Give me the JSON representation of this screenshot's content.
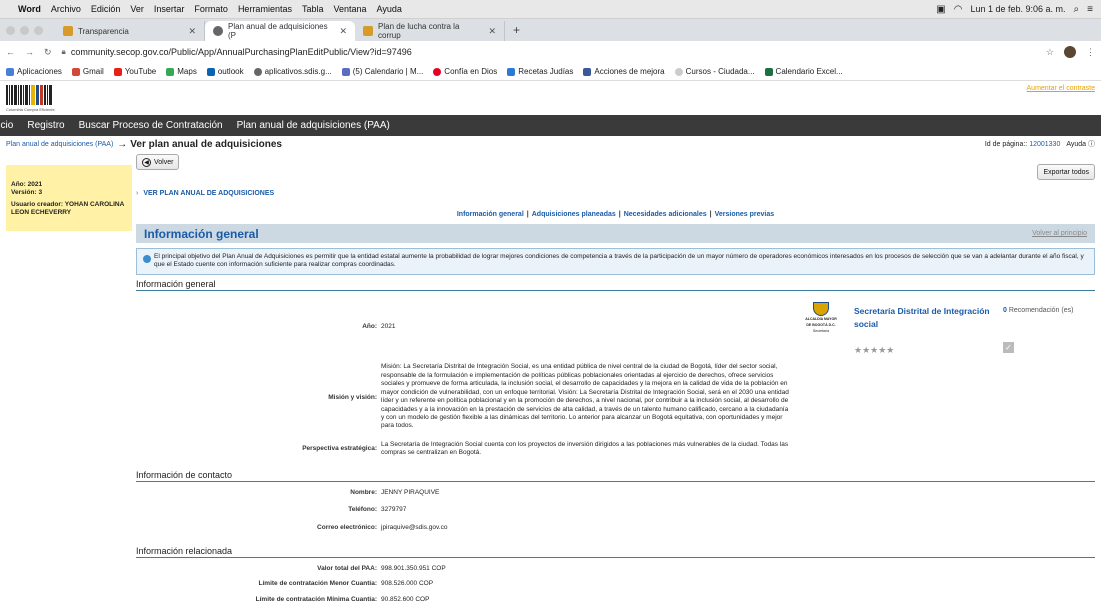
{
  "macbar": {
    "app": "Word",
    "menus": [
      "Archivo",
      "Edición",
      "Ver",
      "Insertar",
      "Formato",
      "Herramientas",
      "Tabla",
      "Ventana",
      "Ayuda"
    ],
    "datetime": "Lun 1 de feb. 9:06 a. m."
  },
  "tabs": [
    {
      "label": "Transparencia"
    },
    {
      "label": "Plan anual de adquisiciones (P"
    },
    {
      "label": "Plan de lucha contra la corrup"
    }
  ],
  "browser": {
    "url": "community.secop.gov.co/Public/App/AnnualPurchasingPlanEditPublic/View?id=97496"
  },
  "bookmarks": [
    "Aplicaciones",
    "Gmail",
    "YouTube",
    "Maps",
    "outlook",
    "aplicativos.sdis.g...",
    "(5) Calendario | M...",
    "Confía en Dios",
    "Recetas Judías",
    "Acciones de mejora",
    "Cursos - Ciudada...",
    "Calendario Excel..."
  ],
  "site": {
    "logo_text": "Colombia Compra Eficiente",
    "contrast_link": "Aumentar el contraste",
    "nav": [
      "Inicio",
      "Registro",
      "Buscar Proceso de Contratación",
      "Plan anual de adquisiciones (PAA)"
    ],
    "breadcrumb": "Plan anual de adquisiciones (PAA)",
    "arrow": "→",
    "title": "Ver plan anual de adquisiciones",
    "page_id_label": "Id de página::",
    "page_id": "12001330",
    "help": "Ayuda"
  },
  "left": {
    "year": "Año: 2021",
    "version": "Versión: 3",
    "creator": "Usuario creador: YOHAN CAROLINA LEON ECHEVERRY"
  },
  "buttons": {
    "back": "Volver",
    "export": "Exportar todos"
  },
  "ver_plan": "VER PLAN ANUAL DE ADQUISICIONES",
  "section_links": [
    "Información general",
    "Adquisiciones planeadas",
    "Necesidades adicionales",
    "Versiones previas"
  ],
  "info_header": {
    "title": "Información general",
    "back_top": "Volver al principio"
  },
  "info_text": "El principal objetivo del Plan Anual de Adquisiciones es permitir que la entidad estatal aumente la probabilidad de lograr mejores condiciones de competencia a través de la participación de un mayor número de operadores económicos interesados en los procesos de selección que se van a adelantar durante el año fiscal, y que el Estado cuente con información suficiente para realizar compras coordinadas.",
  "general": {
    "subhead": "Información general",
    "year_label": "Año:",
    "year": "2021",
    "mision_label": "Misión y visión:",
    "mision": "Misión: La Secretaría Distrital de Integración Social, es una entidad pública de nivel central de la ciudad de Bogotá, líder del sector social, responsable de la formulación e implementación de políticas públicas poblacionales orientadas al ejercicio de derechos, ofrece servicios sociales y promueve de forma articulada, la inclusión social, el desarrollo de capacidades y la mejora en la calidad de vida de la población en mayor condición de vulnerabilidad, con un enfoque territorial. Visión: La Secretaría Distrital de Integración Social, será en el 2030 una entidad líder y un referente en política poblacional y en la promoción de derechos, a nivel nacional, por contribuir a la inclusión social, al desarrollo de capacidades y a la innovación en la prestación de servicios de alta calidad, a través de un talento humano calificado, cercano a la ciudadanía y con un modelo de gestión flexible a las dinámicas del territorio. Lo anterior para alcanzar un Bogotá equitativa, con oportunidades y mejor para todos.",
    "perspectiva_label": "Perspectiva estratégica:",
    "perspectiva": "La Secretaría de Integración Social cuenta con los proyectos de inversión dirigidos a las poblaciones más vulnerables de la ciudad. Todas las compras se centralizan en Bogotá."
  },
  "entity": {
    "badge_line1": "ALCALDÍA MAYOR",
    "badge_line2": "DE BOGOTÁ D.C.",
    "badge_line3": "Secretaría",
    "name": "Secretaría Distrital de Integración social",
    "rec_count": "0",
    "rec_label": "Recomendación (es)",
    "stars": "★★★★★"
  },
  "contact": {
    "subhead": "Información de contacto",
    "name_label": "Nombre:",
    "name": "JENNY PIRAQUIVE",
    "phone_label": "Teléfono:",
    "phone": "3279797",
    "email_label": "Correo electrónico:",
    "email": "jpiraquive@sdis.gov.co"
  },
  "related": {
    "subhead": "Información relacionada",
    "total_label": "Valor total del PAA:",
    "total": "998.901.350.951 COP",
    "menor_label": "Límite de contratación Menor Cuantía:",
    "menor": "908.526.000 COP",
    "minima_label": "Límite de contratación Mínima Cuantía:",
    "minima": "90.852.600 COP"
  }
}
